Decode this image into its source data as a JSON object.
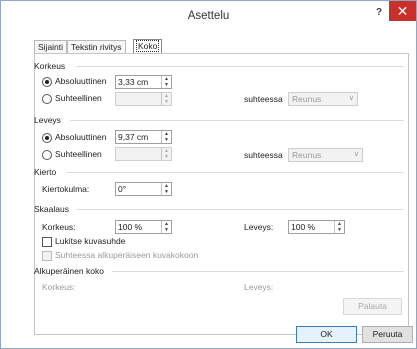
{
  "window": {
    "title": "Asettelu",
    "help": "?",
    "close": "✕"
  },
  "tabs": [
    {
      "label": "Sijainti",
      "active": false
    },
    {
      "label": "Tekstin rivitys",
      "active": false
    },
    {
      "label": "Koko",
      "active": true
    }
  ],
  "height": {
    "section": "Korkeus",
    "absolute_label": "Absoluuttinen",
    "absolute_value": "3,33 cm",
    "relative_label": "Suhteellinen",
    "relative_to_label": "suhteessa",
    "relative_to_value": "Reunus"
  },
  "width": {
    "section": "Leveys",
    "absolute_label": "Absoluuttinen",
    "absolute_value": "9,37 cm",
    "relative_label": "Suhteellinen",
    "relative_to_label": "suhteessa",
    "relative_to_value": "Reunus"
  },
  "rotation": {
    "section": "Kierto",
    "label": "Kiertokulma:",
    "value": "0°"
  },
  "scale": {
    "section": "Skaalaus",
    "height_label": "Korkeus:",
    "height_value": "100 %",
    "width_label": "Leveys:",
    "width_value": "100 %",
    "lock_label": "Lukitse kuvasuhde",
    "relative_original_label": "Suhteessa alkuperäiseen kuvakokoon"
  },
  "original": {
    "section": "Alkuperäinen koko",
    "height_label": "Korkeus:",
    "width_label": "Leveys:",
    "reset_label": "Palauta"
  },
  "buttons": {
    "ok": "OK",
    "cancel": "Peruuta"
  },
  "icons": {
    "spin": "spinner-arrows",
    "drop": "chevron-down-icon",
    "close": "close-icon",
    "help": "help-icon"
  }
}
